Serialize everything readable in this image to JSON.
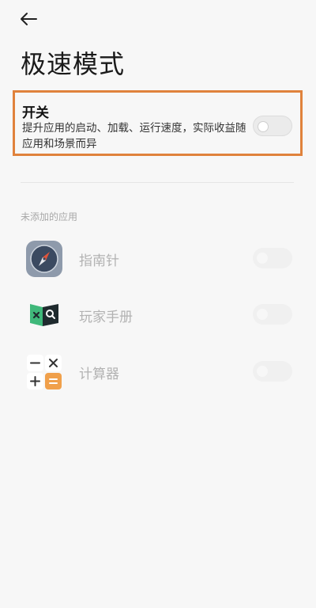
{
  "header": {
    "back_icon": "arrow-left-icon",
    "title": "极速模式"
  },
  "switch": {
    "title": "开关",
    "description": "提升应用的启动、加载、运行速度，实际收益随应用和场景而异",
    "state": "off"
  },
  "section": {
    "label": "未添加的应用"
  },
  "apps": [
    {
      "name": "指南针",
      "icon": "compass-icon",
      "enabled": false
    },
    {
      "name": "玩家手册",
      "icon": "player-handbook-icon",
      "enabled": false
    },
    {
      "name": "计算器",
      "icon": "calculator-icon",
      "enabled": false
    }
  ],
  "colors": {
    "highlight_border": "#e0823c",
    "background": "#f7f7f7"
  }
}
